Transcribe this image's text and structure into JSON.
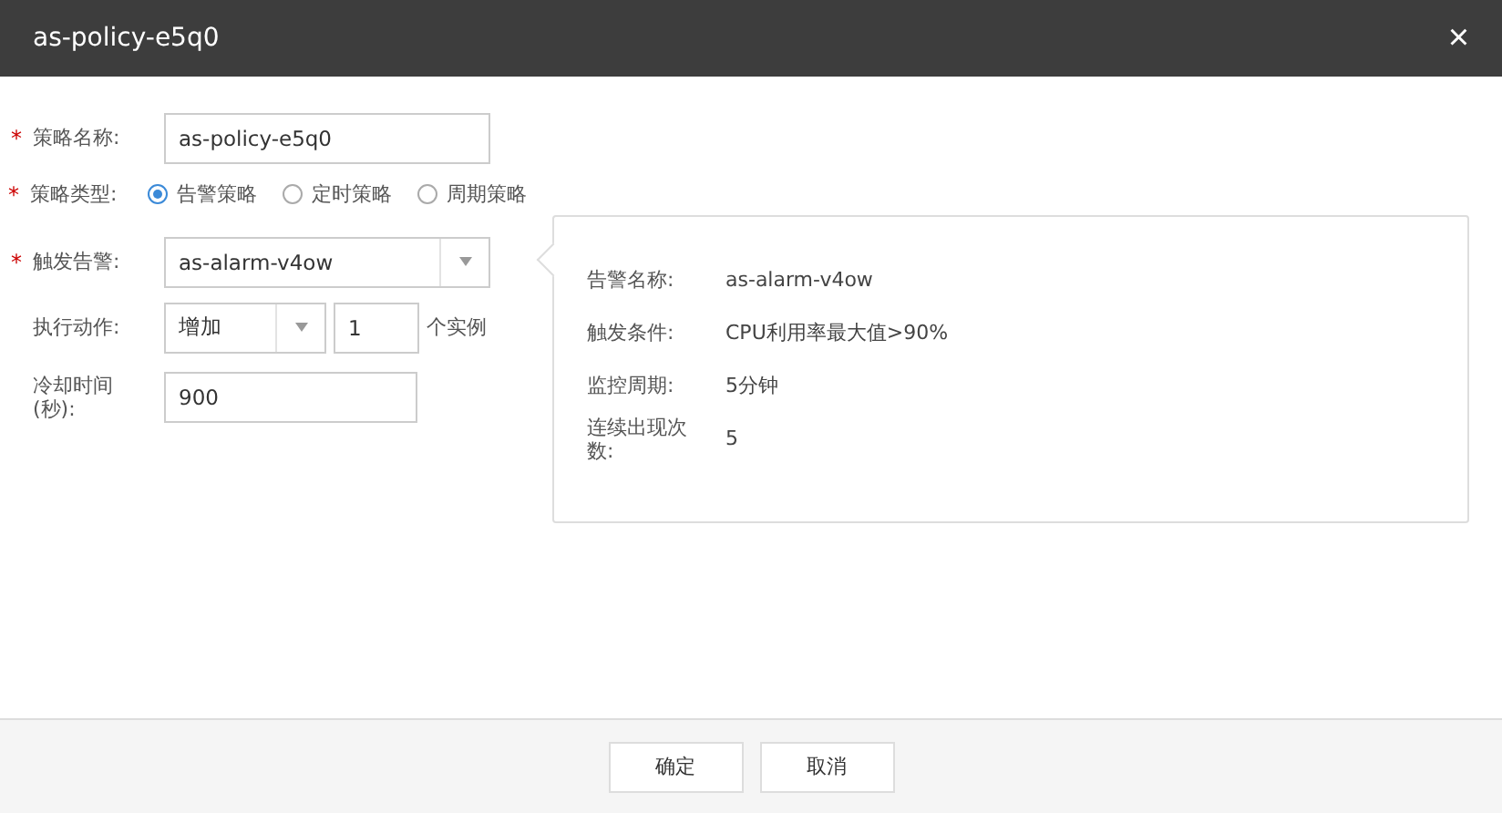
{
  "window": {
    "title": "as-policy-e5q0",
    "close": "×"
  },
  "fields": [
    {
      "kind": "text",
      "label": "策略名称:",
      "required_mark": "*",
      "value": "as-policy-e5q0"
    },
    {
      "kind": "radio",
      "label": "策略类型:",
      "required_mark": "*",
      "options": [
        {
          "label": "告警策略",
          "selected": true
        },
        {
          "label": "定时策略",
          "selected": false
        },
        {
          "label": "周期策略",
          "selected": false
        }
      ]
    },
    {
      "kind": "select",
      "label": "触发告警:",
      "required_mark": "*",
      "value": "as-alarm-v4ow"
    },
    {
      "kind": "action",
      "label": "执行动作:",
      "value": "增加",
      "count": "1",
      "unit": "个实例"
    },
    {
      "kind": "short",
      "label": "冷却时间 (秒):",
      "value": "900"
    }
  ],
  "alarm_details": [
    {
      "label": "告警名称:",
      "value": "as-alarm-v4ow"
    },
    {
      "label": "触发条件:",
      "value": "CPU利用率最大值>90%"
    },
    {
      "label": "监控周期:",
      "value": "5分钟"
    },
    {
      "label": "连续出现次数:",
      "value": "5"
    }
  ],
  "buttons": [
    "确定",
    "取消"
  ]
}
